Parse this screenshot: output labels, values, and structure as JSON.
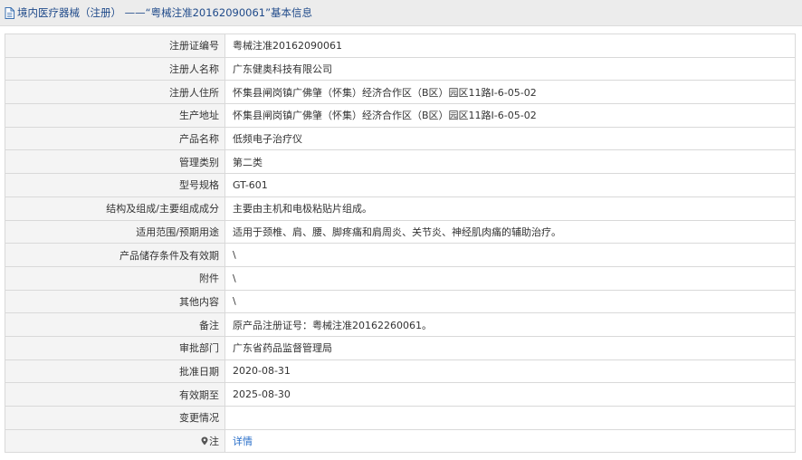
{
  "header": {
    "icon": "document-icon",
    "title": "境内医疗器械（注册） ——“粤械注准20162090061”基本信息"
  },
  "rows": [
    {
      "label": "注册证编号",
      "value": "粤械注准20162090061"
    },
    {
      "label": "注册人名称",
      "value": "广东健奥科技有限公司"
    },
    {
      "label": "注册人住所",
      "value": "怀集县闸岗镇广佛肇（怀集）经济合作区（B区）园区11路I-6-05-02"
    },
    {
      "label": "生产地址",
      "value": "怀集县闸岗镇广佛肇（怀集）经济合作区（B区）园区11路I-6-05-02"
    },
    {
      "label": "产品名称",
      "value": "低频电子治疗仪"
    },
    {
      "label": "管理类别",
      "value": "第二类"
    },
    {
      "label": "型号规格",
      "value": "GT-601"
    },
    {
      "label": "结构及组成/主要组成成分",
      "value": "主要由主机和电极粘贴片组成。"
    },
    {
      "label": "适用范围/预期用途",
      "value": "适用于颈椎、肩、腰、脚疼痛和肩周炎、关节炎、神经肌肉痛的辅助治疗。"
    },
    {
      "label": "产品储存条件及有效期",
      "value": "\\"
    },
    {
      "label": "附件",
      "value": "\\"
    },
    {
      "label": "其他内容",
      "value": "\\"
    },
    {
      "label": "备注",
      "value": "原产品注册证号：粤械注准20162260061。"
    },
    {
      "label": "审批部门",
      "value": "广东省药品监督管理局"
    },
    {
      "label": "批准日期",
      "value": "2020-08-31"
    },
    {
      "label": "有效期至",
      "value": "2025-08-30"
    },
    {
      "label": "变更情况",
      "value": ""
    }
  ],
  "note_row": {
    "icon": "map-pin-icon",
    "label": "注",
    "link_text": "详情",
    "link_color": "#2a6fc9"
  }
}
